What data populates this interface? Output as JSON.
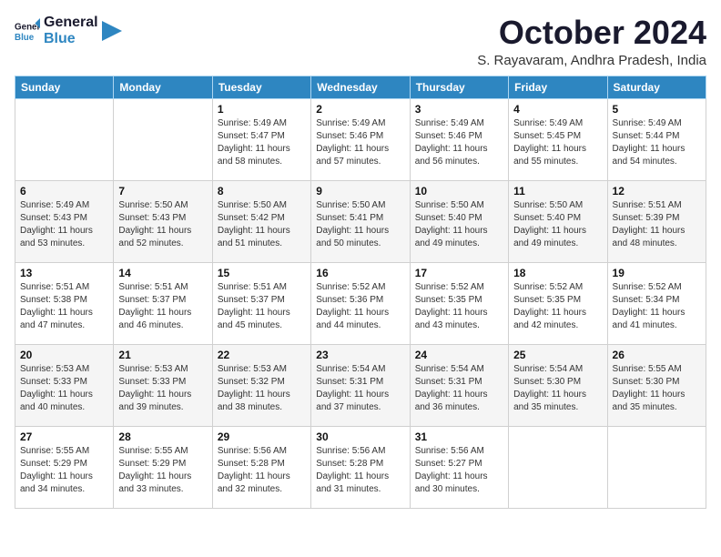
{
  "header": {
    "logo_line1": "General",
    "logo_line2": "Blue",
    "month": "October 2024",
    "location": "S. Rayavaram, Andhra Pradesh, India"
  },
  "days_of_week": [
    "Sunday",
    "Monday",
    "Tuesday",
    "Wednesday",
    "Thursday",
    "Friday",
    "Saturday"
  ],
  "weeks": [
    [
      {
        "num": "",
        "sunrise": "",
        "sunset": "",
        "daylight": ""
      },
      {
        "num": "",
        "sunrise": "",
        "sunset": "",
        "daylight": ""
      },
      {
        "num": "1",
        "sunrise": "Sunrise: 5:49 AM",
        "sunset": "Sunset: 5:47 PM",
        "daylight": "Daylight: 11 hours and 58 minutes."
      },
      {
        "num": "2",
        "sunrise": "Sunrise: 5:49 AM",
        "sunset": "Sunset: 5:46 PM",
        "daylight": "Daylight: 11 hours and 57 minutes."
      },
      {
        "num": "3",
        "sunrise": "Sunrise: 5:49 AM",
        "sunset": "Sunset: 5:46 PM",
        "daylight": "Daylight: 11 hours and 56 minutes."
      },
      {
        "num": "4",
        "sunrise": "Sunrise: 5:49 AM",
        "sunset": "Sunset: 5:45 PM",
        "daylight": "Daylight: 11 hours and 55 minutes."
      },
      {
        "num": "5",
        "sunrise": "Sunrise: 5:49 AM",
        "sunset": "Sunset: 5:44 PM",
        "daylight": "Daylight: 11 hours and 54 minutes."
      }
    ],
    [
      {
        "num": "6",
        "sunrise": "Sunrise: 5:49 AM",
        "sunset": "Sunset: 5:43 PM",
        "daylight": "Daylight: 11 hours and 53 minutes."
      },
      {
        "num": "7",
        "sunrise": "Sunrise: 5:50 AM",
        "sunset": "Sunset: 5:43 PM",
        "daylight": "Daylight: 11 hours and 52 minutes."
      },
      {
        "num": "8",
        "sunrise": "Sunrise: 5:50 AM",
        "sunset": "Sunset: 5:42 PM",
        "daylight": "Daylight: 11 hours and 51 minutes."
      },
      {
        "num": "9",
        "sunrise": "Sunrise: 5:50 AM",
        "sunset": "Sunset: 5:41 PM",
        "daylight": "Daylight: 11 hours and 50 minutes."
      },
      {
        "num": "10",
        "sunrise": "Sunrise: 5:50 AM",
        "sunset": "Sunset: 5:40 PM",
        "daylight": "Daylight: 11 hours and 49 minutes."
      },
      {
        "num": "11",
        "sunrise": "Sunrise: 5:50 AM",
        "sunset": "Sunset: 5:40 PM",
        "daylight": "Daylight: 11 hours and 49 minutes."
      },
      {
        "num": "12",
        "sunrise": "Sunrise: 5:51 AM",
        "sunset": "Sunset: 5:39 PM",
        "daylight": "Daylight: 11 hours and 48 minutes."
      }
    ],
    [
      {
        "num": "13",
        "sunrise": "Sunrise: 5:51 AM",
        "sunset": "Sunset: 5:38 PM",
        "daylight": "Daylight: 11 hours and 47 minutes."
      },
      {
        "num": "14",
        "sunrise": "Sunrise: 5:51 AM",
        "sunset": "Sunset: 5:37 PM",
        "daylight": "Daylight: 11 hours and 46 minutes."
      },
      {
        "num": "15",
        "sunrise": "Sunrise: 5:51 AM",
        "sunset": "Sunset: 5:37 PM",
        "daylight": "Daylight: 11 hours and 45 minutes."
      },
      {
        "num": "16",
        "sunrise": "Sunrise: 5:52 AM",
        "sunset": "Sunset: 5:36 PM",
        "daylight": "Daylight: 11 hours and 44 minutes."
      },
      {
        "num": "17",
        "sunrise": "Sunrise: 5:52 AM",
        "sunset": "Sunset: 5:35 PM",
        "daylight": "Daylight: 11 hours and 43 minutes."
      },
      {
        "num": "18",
        "sunrise": "Sunrise: 5:52 AM",
        "sunset": "Sunset: 5:35 PM",
        "daylight": "Daylight: 11 hours and 42 minutes."
      },
      {
        "num": "19",
        "sunrise": "Sunrise: 5:52 AM",
        "sunset": "Sunset: 5:34 PM",
        "daylight": "Daylight: 11 hours and 41 minutes."
      }
    ],
    [
      {
        "num": "20",
        "sunrise": "Sunrise: 5:53 AM",
        "sunset": "Sunset: 5:33 PM",
        "daylight": "Daylight: 11 hours and 40 minutes."
      },
      {
        "num": "21",
        "sunrise": "Sunrise: 5:53 AM",
        "sunset": "Sunset: 5:33 PM",
        "daylight": "Daylight: 11 hours and 39 minutes."
      },
      {
        "num": "22",
        "sunrise": "Sunrise: 5:53 AM",
        "sunset": "Sunset: 5:32 PM",
        "daylight": "Daylight: 11 hours and 38 minutes."
      },
      {
        "num": "23",
        "sunrise": "Sunrise: 5:54 AM",
        "sunset": "Sunset: 5:31 PM",
        "daylight": "Daylight: 11 hours and 37 minutes."
      },
      {
        "num": "24",
        "sunrise": "Sunrise: 5:54 AM",
        "sunset": "Sunset: 5:31 PM",
        "daylight": "Daylight: 11 hours and 36 minutes."
      },
      {
        "num": "25",
        "sunrise": "Sunrise: 5:54 AM",
        "sunset": "Sunset: 5:30 PM",
        "daylight": "Daylight: 11 hours and 35 minutes."
      },
      {
        "num": "26",
        "sunrise": "Sunrise: 5:55 AM",
        "sunset": "Sunset: 5:30 PM",
        "daylight": "Daylight: 11 hours and 35 minutes."
      }
    ],
    [
      {
        "num": "27",
        "sunrise": "Sunrise: 5:55 AM",
        "sunset": "Sunset: 5:29 PM",
        "daylight": "Daylight: 11 hours and 34 minutes."
      },
      {
        "num": "28",
        "sunrise": "Sunrise: 5:55 AM",
        "sunset": "Sunset: 5:29 PM",
        "daylight": "Daylight: 11 hours and 33 minutes."
      },
      {
        "num": "29",
        "sunrise": "Sunrise: 5:56 AM",
        "sunset": "Sunset: 5:28 PM",
        "daylight": "Daylight: 11 hours and 32 minutes."
      },
      {
        "num": "30",
        "sunrise": "Sunrise: 5:56 AM",
        "sunset": "Sunset: 5:28 PM",
        "daylight": "Daylight: 11 hours and 31 minutes."
      },
      {
        "num": "31",
        "sunrise": "Sunrise: 5:56 AM",
        "sunset": "Sunset: 5:27 PM",
        "daylight": "Daylight: 11 hours and 30 minutes."
      },
      {
        "num": "",
        "sunrise": "",
        "sunset": "",
        "daylight": ""
      },
      {
        "num": "",
        "sunrise": "",
        "sunset": "",
        "daylight": ""
      }
    ]
  ]
}
